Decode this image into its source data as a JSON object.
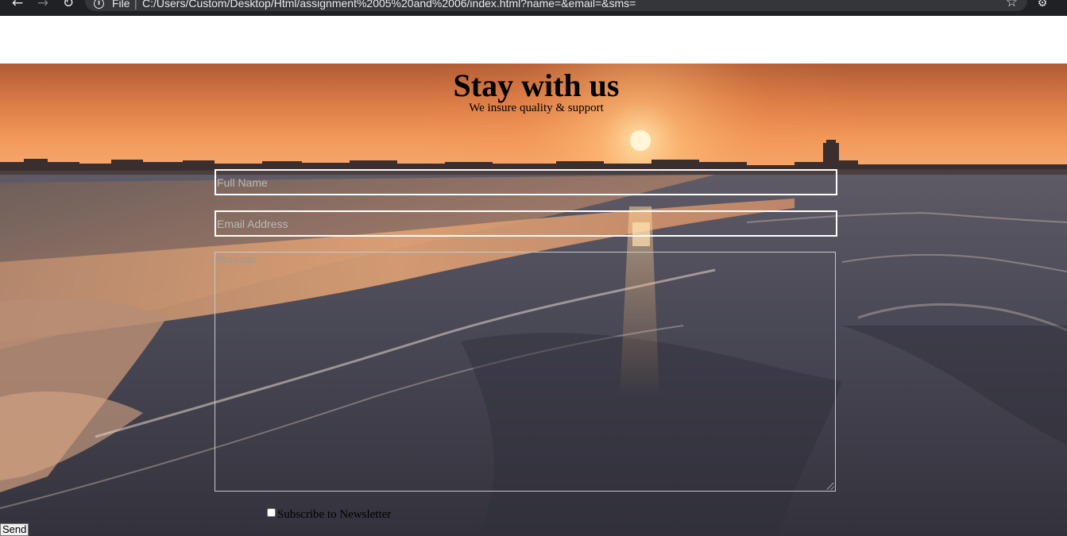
{
  "browser": {
    "back_icon": "arrow-left-icon",
    "forward_icon": "arrow-right-icon",
    "reload_icon": "reload-icon",
    "info_icon": "info-icon",
    "scheme_label": "File",
    "separator": "|",
    "url": "C:/Users/Custom/Desktop/Html/assignment%2005%20and%2006/index.html?name=&email=&sms=",
    "bookmark_icon": "star-icon",
    "extension_icon": "extension-icon"
  },
  "header": {
    "title": "Stay with us",
    "tagline": "We insure quality & support"
  },
  "form": {
    "name_placeholder": "Full Name",
    "email_placeholder": "Email Address",
    "message_placeholder": "Message",
    "newsletter_label": "Subscribe to Newsletter",
    "newsletter_checked": false,
    "send_label": "Send"
  },
  "colors": {
    "browser_bar": "#202124",
    "omnibox": "#35363a",
    "field_border": "#ffffff",
    "sky_top": "#b05b35",
    "sun": "#fff6d8"
  }
}
